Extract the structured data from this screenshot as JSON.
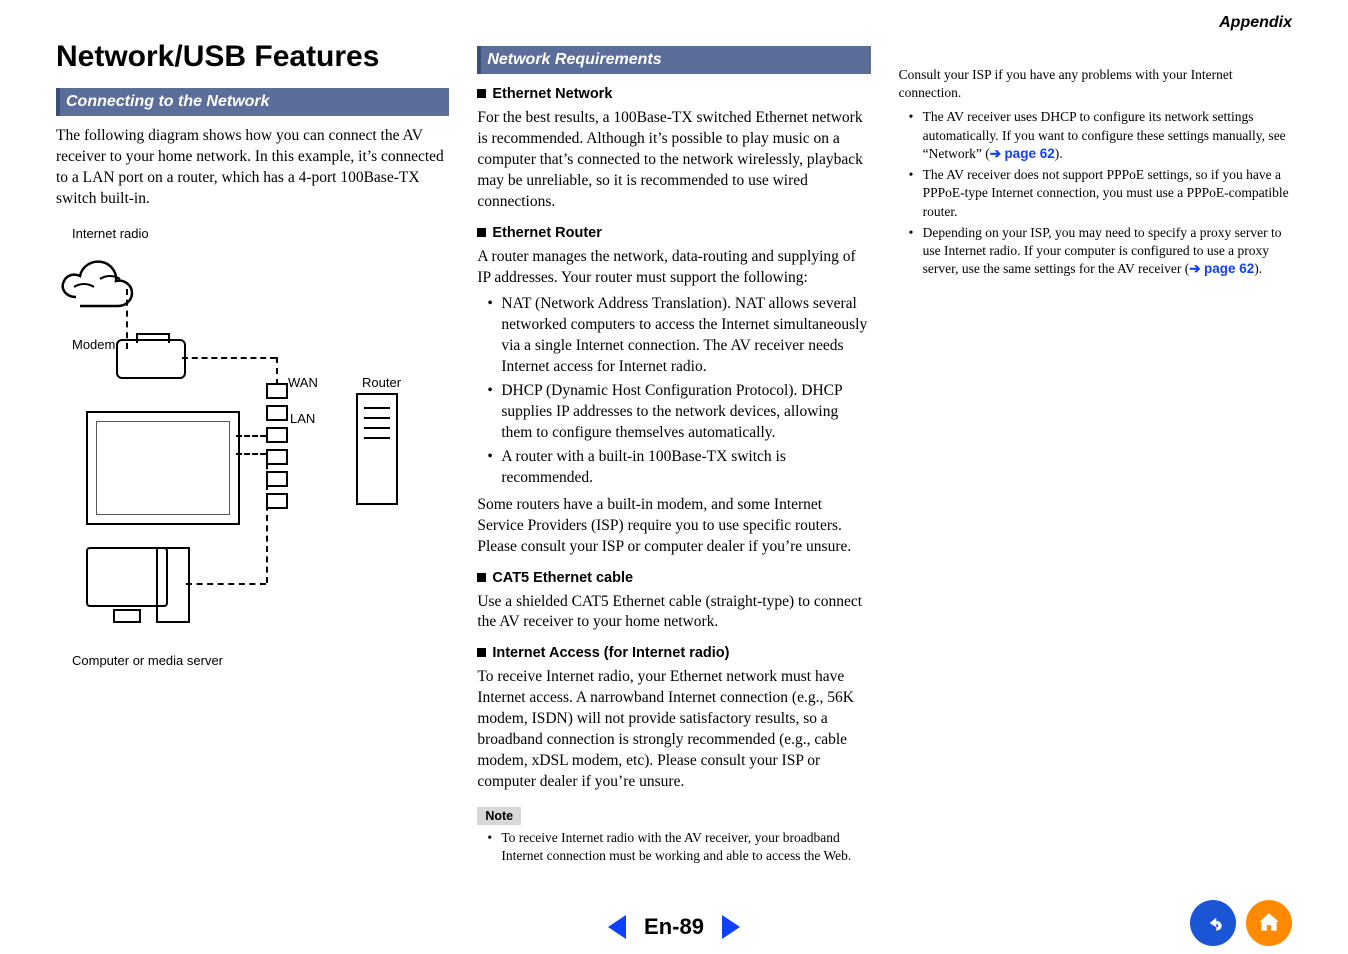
{
  "appendix_label": "Appendix",
  "page_title": "Network/USB Features",
  "col1": {
    "section": "Connecting to the Network",
    "intro": "The following diagram shows how you can connect the AV receiver to your home network. In this example, it’s connected to a LAN port on a router, which has a 4-port 100Base-TX switch built-in.",
    "diagram": {
      "internet_radio": "Internet radio",
      "modem": "Modem",
      "wan": "WAN",
      "lan": "LAN",
      "router": "Router",
      "computer": "Computer or media server"
    }
  },
  "col2": {
    "section": "Network Requirements",
    "eth_net_h": "Ethernet Network",
    "eth_net_p": "For the best results, a 100Base-TX switched Ethernet network is recommended. Although it’s possible to play music on a computer that’s connected to the network wirelessly, playback may be unreliable, so it is recommended to use wired connections.",
    "eth_router_h": "Ethernet Router",
    "eth_router_p": "A router manages the network, data-routing and supplying of IP addresses. Your router must support the following:",
    "router_list": [
      "NAT (Network Address Translation). NAT allows several networked computers to access the Internet simultaneously via a single Internet connection. The AV receiver needs Internet access for Internet radio.",
      "DHCP (Dynamic Host Configuration Protocol). DHCP supplies IP addresses to the network devices, allowing them to configure themselves automatically.",
      "A router with a built-in 100Base-TX switch is recommended."
    ],
    "router_post": "Some routers have a built-in modem, and some Internet Service Providers (ISP) require you to use specific routers. Please consult your ISP or computer dealer if you’re unsure.",
    "cat5_h": "CAT5 Ethernet cable",
    "cat5_p": "Use a shielded CAT5 Ethernet cable (straight-type) to connect the AV receiver to your home network.",
    "inet_h": "Internet Access (for Internet radio)",
    "inet_p": "To receive Internet radio, your Ethernet network must have Internet access. A narrowband Internet connection (e.g., 56K modem, ISDN) will not provide satisfactory results, so a broadband connection is strongly recommended (e.g., cable modem, xDSL modem, etc). Please consult your ISP or computer dealer if you’re unsure.",
    "note_label": "Note",
    "note1": "To receive Internet radio with the AV receiver, your broadband Internet connection must be working and able to access the Web."
  },
  "col3": {
    "cont": "Consult your ISP if you have any problems with your Internet connection.",
    "b1a": "The AV receiver uses DHCP to configure its network settings automatically. If you want to configure these settings manually, see “Network” (",
    "b1link": "page 62",
    "b1b": ").",
    "b2": "The AV receiver does not support PPPoE settings, so if you have a PPPoE-type Internet connection, you must use a PPPoE-compatible router.",
    "b3a": "Depending on your ISP, you may need to specify a proxy server to use Internet radio. If your computer is configured to use a proxy server, use the same settings for the AV receiver (",
    "b3link": "page 62",
    "b3b": ")."
  },
  "footer": {
    "page": "En-89"
  }
}
